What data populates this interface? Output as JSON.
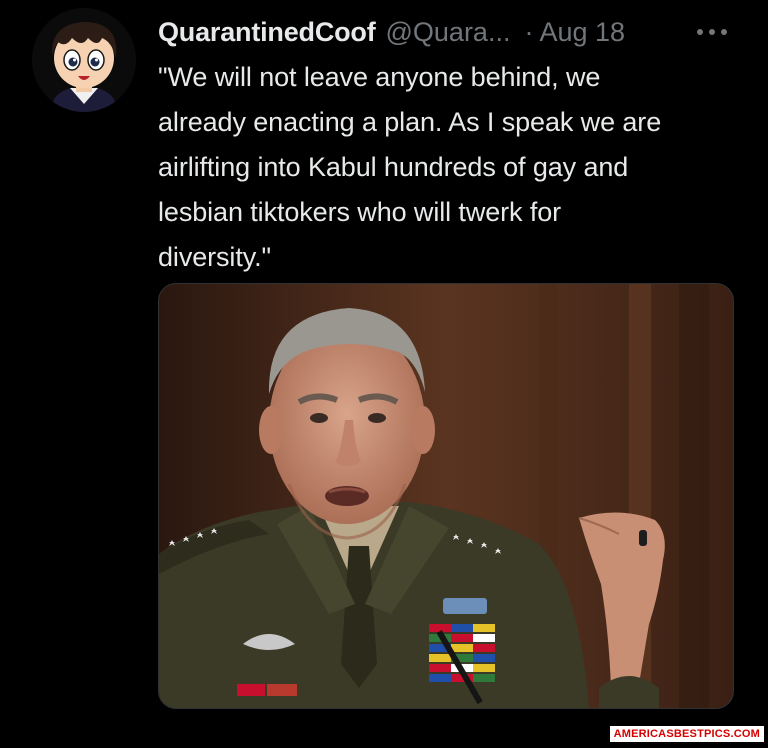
{
  "tweet": {
    "display_name": "QuarantinedCoof",
    "handle": "@Quara...",
    "separator": "·",
    "date": "Aug 18",
    "text": "\"We will not leave anyone behind, we\nalready enacting a plan.  As I speak we are\nairlifting into Kabul hundreds of gay and\nlesbian tiktokers who will twerk for\ndiversity.\"",
    "more_icon": "more-horizontal-icon",
    "avatar_icon": "anime-character-avatar",
    "media_description": "military officer in uniform speaking at hearing"
  },
  "watermark": {
    "text": "AMERICASBESTPICS.COM"
  },
  "colors": {
    "background": "#000000",
    "text_primary": "#e7e9ea",
    "text_secondary": "#71767b",
    "watermark_text": "#d60000"
  }
}
